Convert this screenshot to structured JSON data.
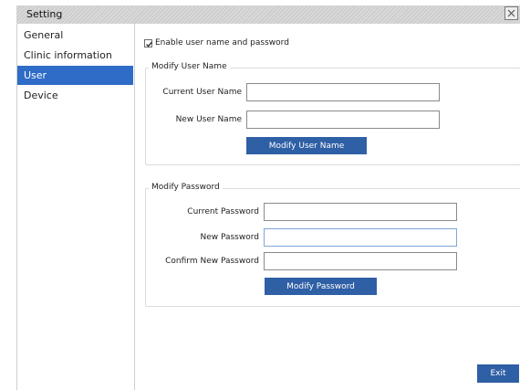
{
  "window": {
    "title": "Setting",
    "close_icon": "close-icon"
  },
  "sidebar": {
    "items": [
      {
        "label": "General"
      },
      {
        "label": "Clinic information"
      },
      {
        "label": "User",
        "active": true
      },
      {
        "label": "Device"
      }
    ]
  },
  "user": {
    "enable_label": "Enable user name and password",
    "enable_checked": true,
    "modify_username": {
      "legend": "Modify User Name",
      "current_label": "Current User Name",
      "current_value": "",
      "new_label": "New User Name",
      "new_value": "",
      "button": "Modify User Name"
    },
    "modify_password": {
      "legend": "Modify Password",
      "current_label": "Current Password",
      "current_value": "",
      "new_label": "New Password",
      "new_value": "",
      "confirm_label": "Confirm New Password",
      "confirm_value": "",
      "button": "Modify Password"
    }
  },
  "footer": {
    "exit_label": "Exit"
  },
  "colors": {
    "accent": "#2f6cc7",
    "button": "#2f5fa5",
    "titlebar": "#d0d0d0"
  }
}
